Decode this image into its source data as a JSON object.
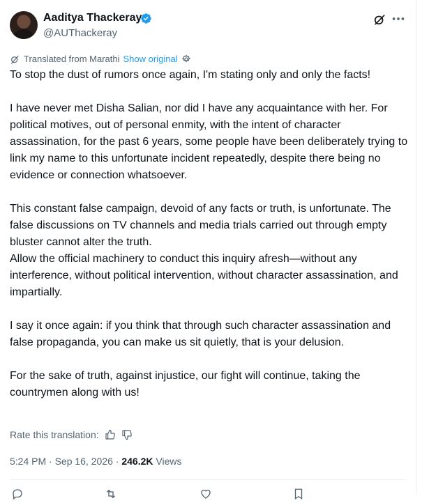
{
  "author": {
    "name": "Aaditya Thackeray",
    "handle": "@AUThackeray",
    "verified": true
  },
  "translation": {
    "label": "Translated from Marathi",
    "show_original": "Show original"
  },
  "tweet": {
    "paragraphs": [
      "To stop the dust of rumors once again, I'm stating only and only the facts!",
      "I have never met Disha Salian, nor did I have any acquaintance with her. For political motives, out of personal enmity, with the intent of character assassination, for the past 6 years, some people have been deliberately trying to link my name to this unfortunate incident repeatedly, despite there being no evidence or connection whatsoever.",
      "This constant false campaign, devoid of any facts or truth, is unfortunate. The false discussions on TV channels and media trials carried out through empty bluster cannot alter the truth.\nAllow the official machinery to conduct this inquiry afresh—without any interference, without political intervention, without character assassination, and impartially.",
      "I say it once again: if you think that through such character assassination and false propaganda, you can make us sit quietly, that is your delusion.",
      "For the sake of truth, against injustice, our fight will continue, taking the countrymen along with us!"
    ]
  },
  "rate_translation": "Rate this translation:",
  "meta": {
    "time": "5:24 PM",
    "separator": "·",
    "date": "Sep 16, 2026",
    "views_count": "246.2K",
    "views_label": "Views"
  },
  "colors": {
    "accent": "#1d9bf0",
    "text": "#0f1419",
    "secondary": "#536471"
  },
  "icons": {
    "verified": "verified-badge-icon",
    "grok": "grok-icon",
    "more": "more-icon",
    "translate": "translate-icon",
    "settings": "gear-icon",
    "thumbs_up": "thumbs-up-icon",
    "thumbs_down": "thumbs-down-icon",
    "reply": "reply-icon",
    "repost": "repost-icon",
    "like": "heart-icon",
    "bookmark": "bookmark-icon"
  }
}
